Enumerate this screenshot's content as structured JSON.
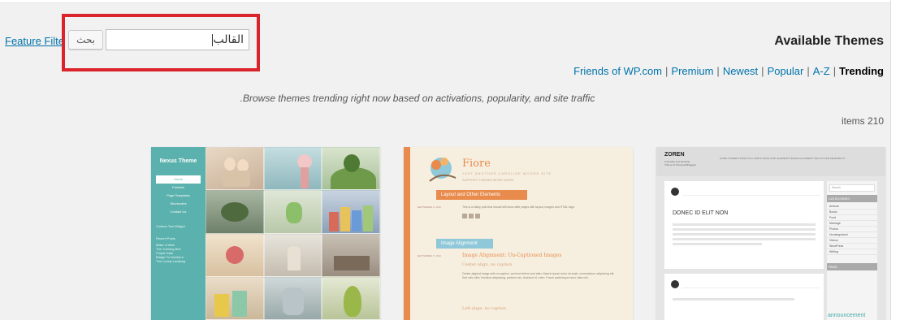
{
  "filter": {
    "feature_filter_label": "Feature Filter"
  },
  "search": {
    "button_label": "بحث",
    "input_value": "القالب"
  },
  "heading": "Available Themes",
  "tabs": [
    {
      "label": "Friends of WP.com"
    },
    {
      "label": "Premium"
    },
    {
      "label": "Newest"
    },
    {
      "label": "Popular"
    },
    {
      "label": "A-Z"
    },
    {
      "label": "Trending"
    }
  ],
  "description": ".Browse themes trending right now based on activations, popularity, and site traffic",
  "items_count": "items 210",
  "themes": [
    {
      "title": "Nexus Theme",
      "nav": [
        "Home",
        "Portfolio",
        "Page Templates",
        "Shortcodes",
        "Contact Us"
      ],
      "widget_title": "Custom Text Widget",
      "recent_title": "Recent Posts",
      "recent": [
        "Make a Wish",
        "The Tutoring Bee",
        "Purple Hats",
        "Bridge To Nowhere",
        "The Lonely Ladybug"
      ]
    },
    {
      "title": "Fiore",
      "subtitle": "JUST ANOTHER CAROLINE MOORE SITE",
      "nav": "SUPPORT   THEMES   MORE WORK",
      "ribbon1": "Layout and Other Elements",
      "ribbon2": "Image Alignment",
      "post1_text": "This is a sticky post that should still show after pages with layout, images and HTML tags.",
      "post2_title": "Image Alignment: Un-Captioned Images",
      "post2_sub": "Center-align, no caption",
      "post2_text": "Center-aligned image with no caption, and text before and after. Mauris ipsum dolor sit amet, consectetuer adipiscing elit. Sed odio nibh, tincidunt adipiscing, pretium nec, tincidunt id, enim. Fusce scelerisque nunc vitae nisl.",
      "post2_sub2": "Left-align, no caption",
      "meta1": "SEPTEMBER 9, 2010",
      "meta2": "SEPTEMBER 5, 2010"
    },
    {
      "title": "ZOREN",
      "tagline": "A Flexible and Versatile Theme for Personal Bloggers",
      "nav": "HOME   A PARENT PAGE   FULL WIDTH PAGE   HTML ELEMENTS   IMAGE ALIGNMENT AND STYLES   READABILITY",
      "post_title": "DONEC ID ELIT NON",
      "search_placeholder": "Search",
      "categories_title": "CATEGORIES",
      "categories": [
        "Artwork",
        "Books",
        "Food",
        "Marriage",
        "Photos",
        "Uncategorized",
        "Videos",
        "WordPress",
        "Writing"
      ],
      "sidebar_title2": "PAGE",
      "announcement": "announcement"
    }
  ],
  "colors": {
    "link": "#0073aa",
    "highlight_border": "#d9242b",
    "nexus_teal": "#5ab1ad",
    "fiore_orange": "#e88b4c"
  }
}
